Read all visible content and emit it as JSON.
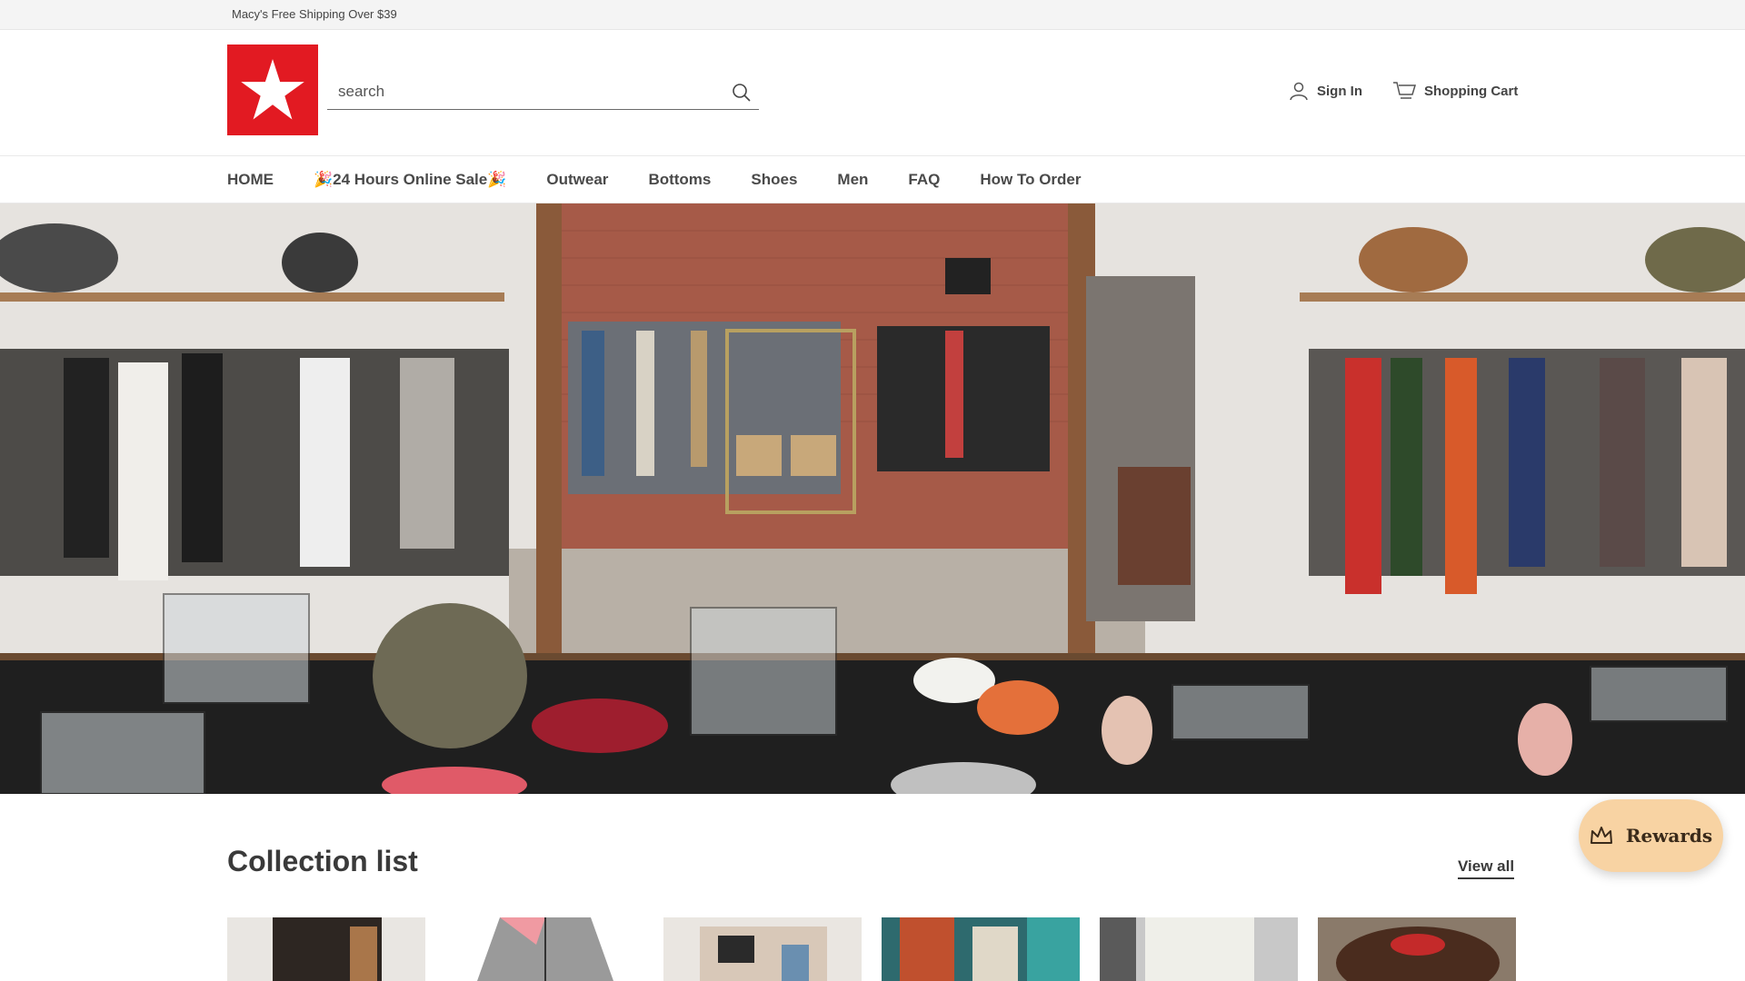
{
  "topbar": {
    "promo_text": "Macy's Free Shipping Over $39"
  },
  "header": {
    "logo": {
      "icon": "star-icon",
      "brand_color": "#e21a22"
    },
    "search": {
      "placeholder": "search",
      "value": "",
      "icon": "search-icon"
    },
    "account": {
      "label": "Sign In",
      "icon": "user-icon"
    },
    "cart": {
      "label": "Shopping Cart",
      "icon": "cart-icon"
    }
  },
  "nav": {
    "items": [
      {
        "label": "HOME"
      },
      {
        "label": "🎉24 Hours Online Sale🎉"
      },
      {
        "label": "Outwear"
      },
      {
        "label": "Bottoms"
      },
      {
        "label": "Shoes"
      },
      {
        "label": "Men"
      },
      {
        "label": "FAQ"
      },
      {
        "label": "How To Order"
      }
    ]
  },
  "hero": {
    "image": "boutique-store-interior"
  },
  "collection": {
    "title": "Collection list",
    "view_all": "View all",
    "cards": [
      {
        "image": "brown-coat-with-bag"
      },
      {
        "image": "pink-gray-jacket"
      },
      {
        "image": "printed-blouse"
      },
      {
        "image": "floral-shirt"
      },
      {
        "image": "white-knit-sweater"
      },
      {
        "image": "brown-loafers"
      }
    ]
  },
  "rewards": {
    "label": "Rewards",
    "icon": "crown-icon",
    "color": "#f8d3a3"
  }
}
